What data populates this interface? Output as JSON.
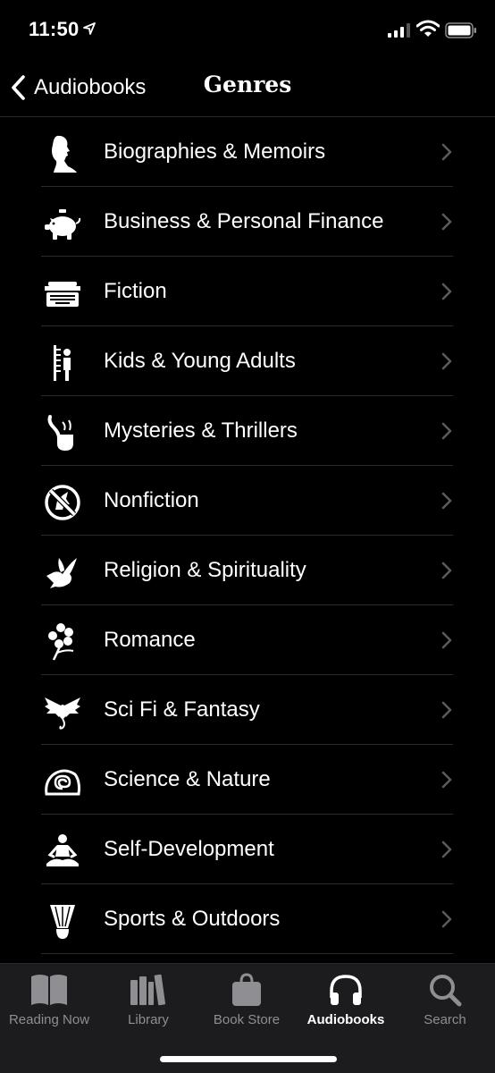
{
  "status_bar": {
    "time": "11:50",
    "icons": [
      "location-arrow-icon",
      "signal-icon",
      "wifi-icon",
      "battery-icon"
    ]
  },
  "nav": {
    "back_label": "Audiobooks",
    "title": "Genres"
  },
  "genres": [
    {
      "label": "Biographies & Memoirs",
      "icon": "silhouette-icon"
    },
    {
      "label": "Business & Personal Finance",
      "icon": "piggy-bank-icon"
    },
    {
      "label": "Fiction",
      "icon": "typewriter-icon"
    },
    {
      "label": "Kids & Young Adults",
      "icon": "height-chart-icon"
    },
    {
      "label": "Mysteries & Thrillers",
      "icon": "pipe-icon"
    },
    {
      "label": "Nonfiction",
      "icon": "no-unicorn-icon"
    },
    {
      "label": "Religion & Spirituality",
      "icon": "dove-icon"
    },
    {
      "label": "Romance",
      "icon": "flower-icon"
    },
    {
      "label": "Sci Fi & Fantasy",
      "icon": "dragon-icon"
    },
    {
      "label": "Science & Nature",
      "icon": "snail-shell-icon"
    },
    {
      "label": "Self-Development",
      "icon": "meditation-icon"
    },
    {
      "label": "Sports & Outdoors",
      "icon": "shuttlecock-icon"
    }
  ],
  "tabs": [
    {
      "label": "Reading Now",
      "icon": "open-book-icon",
      "active": false
    },
    {
      "label": "Library",
      "icon": "books-icon",
      "active": false
    },
    {
      "label": "Book Store",
      "icon": "shopping-bag-icon",
      "active": false
    },
    {
      "label": "Audiobooks",
      "icon": "headphones-icon",
      "active": true
    },
    {
      "label": "Search",
      "icon": "magnifier-icon",
      "active": false
    }
  ],
  "colors": {
    "background": "#000000",
    "separator": "#2c2c2e",
    "tab_bar": "#1c1c1e",
    "inactive": "#8e8e93",
    "active": "#ffffff"
  }
}
